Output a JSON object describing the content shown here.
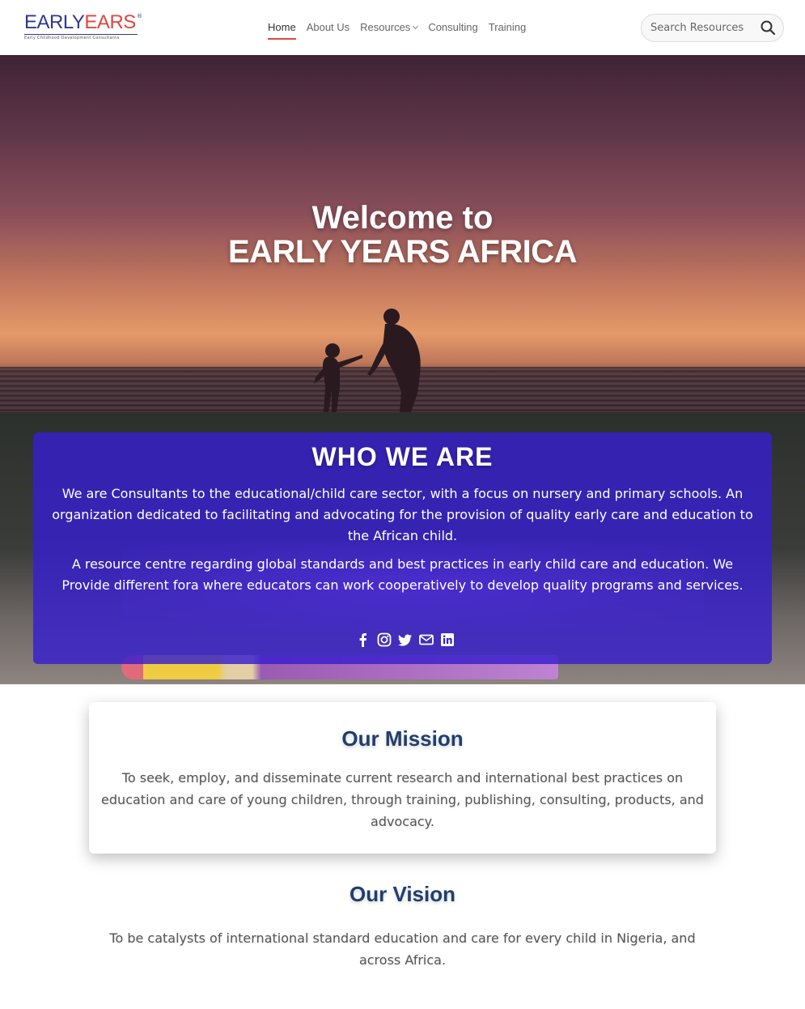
{
  "header": {
    "logo": {
      "word1": "EARLY",
      "word2": "EARS",
      "reg": "®",
      "tagline": "Early Childhood Development Consultants"
    },
    "nav": [
      {
        "label": "Home",
        "active": true
      },
      {
        "label": "About Us",
        "active": false
      },
      {
        "label": "Resources",
        "active": false,
        "has_dropdown": true
      },
      {
        "label": "Consulting",
        "active": false
      },
      {
        "label": "Training",
        "active": false
      }
    ],
    "search": {
      "placeholder": "Search Resources",
      "icon": "search-icon"
    }
  },
  "hero": {
    "line1": "Welcome to",
    "line2": "EARLY YEARS AFRICA"
  },
  "who_we_are": {
    "title": "WHO WE ARE",
    "paragraph1": "We are Consultants to the educational/child care sector, with a focus on nursery and primary schools. An organization dedicated to facilitating and advocating for the provision of quality early care and education to the African child.",
    "paragraph2": "A resource centre regarding global standards and best practices in early child care and education. We Provide different fora where educators can work cooperatively to develop quality programs and services.",
    "socials": [
      "facebook-icon",
      "instagram-icon",
      "twitter-icon",
      "email-icon",
      "linkedin-icon"
    ]
  },
  "mission": {
    "title": "Our Mission",
    "text": "To seek, employ, and disseminate current research and international best practices on education and care of young children, through training, publishing, consulting, products, and advocacy."
  },
  "vision": {
    "title": "Our Vision",
    "text": "To be catalysts of international standard education and care for every child in Nigeria, and across Africa."
  },
  "colors": {
    "brand_blue": "#2e3a8c",
    "brand_red": "#e0463c",
    "card_purple": "#371ecd",
    "heading_navy": "#1f3f6e"
  }
}
